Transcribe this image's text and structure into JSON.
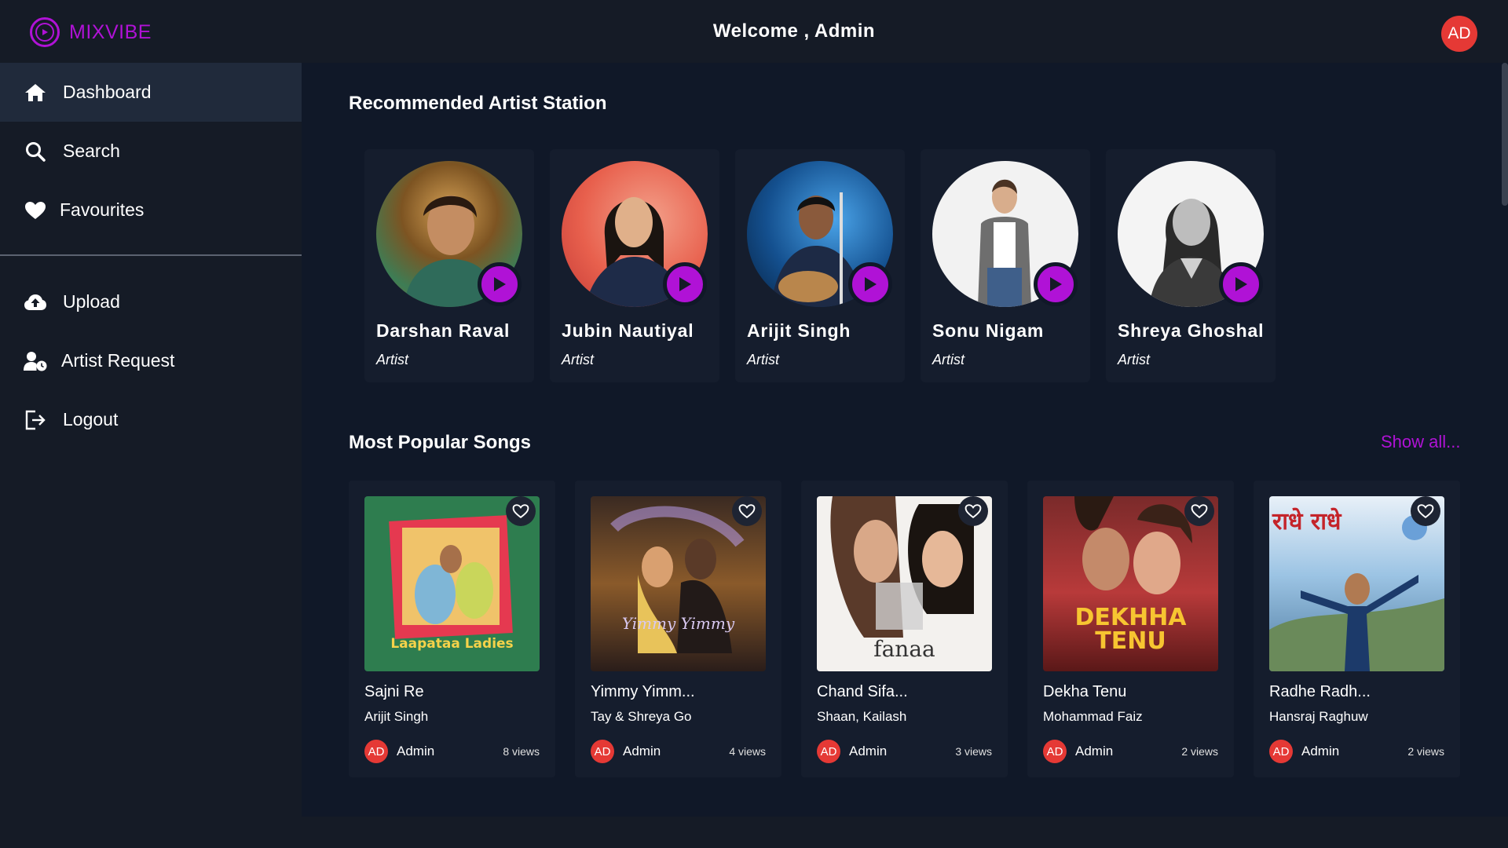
{
  "app": {
    "brand": "MIXVIBE",
    "welcome": "Welcome , Admin",
    "user_initials": "AD"
  },
  "nav": {
    "dashboard": "Dashboard",
    "search": "Search",
    "favourites": "Favourites",
    "upload": "Upload",
    "artist_request": "Artist Request",
    "logout": "Logout"
  },
  "artists_section": {
    "title": "Recommended Artist Station",
    "items": [
      {
        "name": "Darshan Raval",
        "role": "Artist"
      },
      {
        "name": "Jubin Nautiyal",
        "role": "Artist"
      },
      {
        "name": "Arijit Singh",
        "role": "Artist"
      },
      {
        "name": "Sonu Nigam",
        "role": "Artist"
      },
      {
        "name": "Shreya Ghoshal",
        "role": "Artist"
      }
    ]
  },
  "songs_section": {
    "title": "Most Popular Songs",
    "show_all": "Show all...",
    "items": [
      {
        "title": "Sajni Re",
        "artist": "Arijit Singh",
        "uploader": "Admin",
        "uploader_initials": "AD",
        "views": "8 views",
        "cover_text": "Laapataa Ladies"
      },
      {
        "title": "Yimmy Yimm...",
        "artist": "Tay & Shreya Go",
        "uploader": "Admin",
        "uploader_initials": "AD",
        "views": "4 views",
        "cover_text": "Yimmy Yimmy"
      },
      {
        "title": "Chand Sifa...",
        "artist": "Shaan, Kailash",
        "uploader": "Admin",
        "uploader_initials": "AD",
        "views": "3 views",
        "cover_text": "fanaa"
      },
      {
        "title": "Dekha Tenu",
        "artist": "Mohammad Faiz",
        "uploader": "Admin",
        "uploader_initials": "AD",
        "views": "2 views",
        "cover_text": "DEKHHA TENU"
      },
      {
        "title": "Radhe Radh...",
        "artist": "Hansraj Raghuw",
        "uploader": "Admin",
        "uploader_initials": "AD",
        "views": "2 views",
        "cover_text": "राधे राधे"
      }
    ]
  },
  "colors": {
    "accent": "#b012d6",
    "avatar": "#e53935",
    "bg": "#151b26",
    "main_bg": "#101828",
    "card_bg": "#151d2d"
  }
}
